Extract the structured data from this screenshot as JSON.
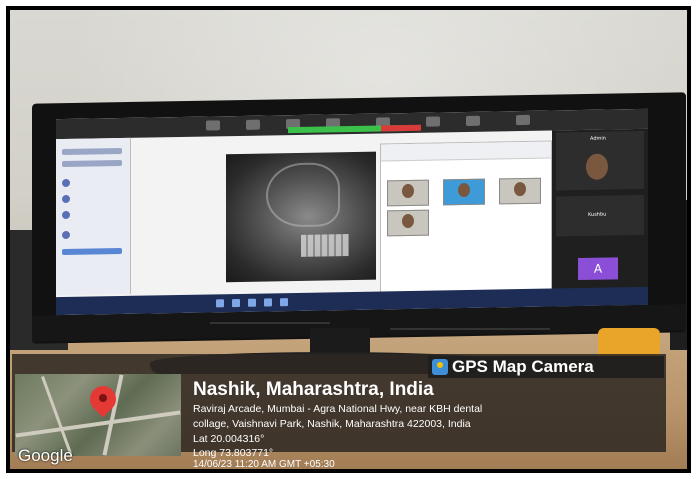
{
  "badge": {
    "label": "GPS Map Camera"
  },
  "location": {
    "title": "Nashik, Maharashtra, India",
    "address_line1": "Raviraj Arcade, Mumbai - Agra National Hwy, near KBH dental",
    "address_line2": "collage, Vaishnavi Park, Nashik, Maharashtra 422003, India",
    "lat": "Lat 20.004316°",
    "long": "Long 73.803771°",
    "timestamp": "14/06/23 11:20 AM GMT +05:30"
  },
  "map": {
    "logo_text": "Google",
    "pin_color": "#e53935"
  },
  "screen": {
    "participants": {
      "host_name": "Admin",
      "tile2_name": "Kushbu",
      "tile3_initial": "A"
    }
  },
  "colors": {
    "overlay_bg": "#2d2822",
    "badge_icon": "#3f8ed8",
    "avatar_purple": "#8a4fd6",
    "toolbar_green": "#3bc14a",
    "toolbar_red": "#d93a3a"
  }
}
